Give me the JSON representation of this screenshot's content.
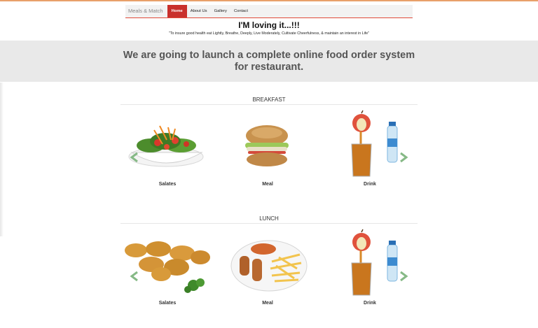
{
  "nav": {
    "brand": "Meals & Match",
    "items": [
      {
        "label": "Home",
        "active": true
      },
      {
        "label": "About Us"
      },
      {
        "label": "Gallery"
      },
      {
        "label": "Contact"
      }
    ],
    "accent": "#c9302c"
  },
  "hero": {
    "title": "I'M loving it...!!!",
    "quote": "\"To insure good health eat Lightly, Breathe, Deeply, Live Moderately, Cultivate Cheerfulness, & maintain an interest in Life\""
  },
  "banner": {
    "text": "We are going to launch a complete online food order system for restaurant."
  },
  "sections": [
    {
      "title": "BREAKFAST",
      "items": [
        {
          "label": "Salates",
          "icon": "salad-bowl-icon"
        },
        {
          "label": "Meal",
          "icon": "sandwich-icon"
        },
        {
          "label": "Drink",
          "icon": "apple-juice-water-bottle-icon"
        }
      ]
    },
    {
      "title": "LUNCH",
      "items": [
        {
          "label": "Salates",
          "icon": "chicken-nuggets-icon"
        },
        {
          "label": "Meal",
          "icon": "fish-and-chips-plate-icon"
        },
        {
          "label": "Drink",
          "icon": "apple-juice-water-bottle-icon"
        }
      ]
    }
  ]
}
